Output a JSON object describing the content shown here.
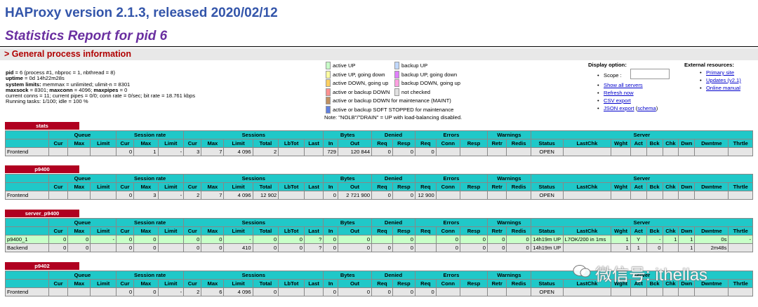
{
  "header": {
    "title": "HAProxy version 2.1.3, released 2020/02/12",
    "subtitle": "Statistics Report for pid 6",
    "section": "> General process information"
  },
  "process_info": [
    {
      "k": "pid",
      "v": " = 6 (process #1, nbproc = 1, nbthread = 8)"
    },
    {
      "k": "uptime",
      "v": " = 0d 14h22m28s"
    },
    {
      "k": "system limits:",
      "v": " memmax = unlimited; ulimit-n = 8301"
    },
    {
      "k": "maxsock",
      "v": " = 8301; "
    },
    {
      "k": "",
      "v": "current conns = 11; current pipes = 0/0; conn rate = 0/sec; bit rate = 18.761 kbps"
    },
    {
      "k": "",
      "v": "Running tasks: 1/100; idle = 100 %"
    }
  ],
  "process_info_extra": {
    "maxconn_label": "maxconn",
    "maxconn_val": " = 4096; ",
    "maxpipes_label": "maxpipes",
    "maxpipes_val": " = 0"
  },
  "legend": {
    "left": [
      {
        "label": "active UP",
        "color": "#c8ffc8"
      },
      {
        "label": "active UP, going down",
        "color": "#ffffa0"
      },
      {
        "label": "active DOWN, going up",
        "color": "#ffd060"
      },
      {
        "label": "active or backup DOWN",
        "color": "#ff9090"
      },
      {
        "label": "active or backup DOWN for maintenance (MAINT)",
        "color": "#c09060"
      },
      {
        "label": "active or backup SOFT STOPPED for maintenance",
        "color": "#6080e0"
      }
    ],
    "right": [
      {
        "label": "backup UP",
        "color": "#c0d8ff"
      },
      {
        "label": "backup UP, going down",
        "color": "#e080ff"
      },
      {
        "label": "backup DOWN, going up",
        "color": "#ffa0e0"
      },
      {
        "label": "not checked",
        "color": "#e0e0e0"
      }
    ],
    "note": "Note: \"NOLB\"/\"DRAIN\" = UP with load-balancing disabled."
  },
  "display_option": {
    "title": "Display option:",
    "scope_label": "Scope :",
    "links": [
      "Show all servers",
      "Refresh now",
      "CSV export",
      "JSON export"
    ],
    "schema_open": " (",
    "schema": "schema",
    "schema_close": ")"
  },
  "external": {
    "title": "External resources:",
    "links": [
      "Primary site",
      "Updates (v2.1)",
      "Online manual"
    ]
  },
  "table_headers": {
    "groups": [
      "Queue",
      "Session rate",
      "Sessions",
      "Bytes",
      "Denied",
      "Errors",
      "Warnings",
      "Server"
    ],
    "cols": [
      "Cur",
      "Max",
      "Limit",
      "Cur",
      "Max",
      "Limit",
      "Cur",
      "Max",
      "Limit",
      "Total",
      "LbTot",
      "Last",
      "In",
      "Out",
      "Req",
      "Resp",
      "Req",
      "Conn",
      "Resp",
      "Retr",
      "Redis",
      "Status",
      "LastChk",
      "Wght",
      "Act",
      "Bck",
      "Chk",
      "Dwn",
      "Dwntme",
      "Thrtle"
    ]
  },
  "proxies": [
    {
      "name": "stats",
      "rows": [
        {
          "kind": "fe",
          "cells": [
            "Frontend",
            "",
            "",
            "",
            "0",
            "1",
            "-",
            "3",
            "7",
            "4 096",
            "2",
            "",
            "",
            "729",
            "120 844",
            "0",
            "0",
            "0",
            "",
            "",
            "",
            "",
            "OPEN",
            "",
            "",
            "",
            "",
            "",
            "",
            "",
            ""
          ]
        }
      ]
    },
    {
      "name": "p9400",
      "rows": [
        {
          "kind": "fe",
          "cells": [
            "Frontend",
            "",
            "",
            "",
            "0",
            "3",
            "-",
            "2",
            "7",
            "4 096",
            "12 902",
            "",
            "",
            "0",
            "2 721 900",
            "0",
            "0",
            "12 900",
            "",
            "",
            "",
            "",
            "OPEN",
            "",
            "",
            "",
            "",
            "",
            "",
            "",
            ""
          ]
        }
      ]
    },
    {
      "name": "server_p9400",
      "rows": [
        {
          "kind": "sv",
          "cells": [
            "p9400_1",
            "0",
            "0",
            "-",
            "0",
            "0",
            "",
            "0",
            "0",
            "-",
            "0",
            "0",
            "?",
            "0",
            "0",
            "",
            "0",
            "",
            "0",
            "0",
            "0",
            "0",
            "14h19m UP",
            "L7OK/200 in 1ms",
            "1",
            "Y",
            "-",
            "1",
            "1",
            "0s",
            "-"
          ]
        },
        {
          "kind": "be",
          "cells": [
            "Backend",
            "0",
            "0",
            "",
            "0",
            "0",
            "",
            "0",
            "0",
            "410",
            "0",
            "0",
            "?",
            "0",
            "0",
            "0",
            "0",
            "",
            "0",
            "0",
            "0",
            "0",
            "14h19m UP",
            "",
            "1",
            "1",
            "0",
            "",
            "1",
            "2m48s",
            ""
          ]
        }
      ]
    },
    {
      "name": "p9402",
      "rows": [
        {
          "kind": "fe",
          "cells": [
            "Frontend",
            "",
            "",
            "",
            "0",
            "0",
            "-",
            "2",
            "6",
            "4 096",
            "0",
            "",
            "",
            "0",
            "0",
            "0",
            "0",
            "0",
            "",
            "",
            "",
            "",
            "OPEN",
            "",
            "",
            "",
            "",
            "",
            "",
            "",
            ""
          ]
        }
      ]
    }
  ],
  "watermark": "微信号: ithellas"
}
